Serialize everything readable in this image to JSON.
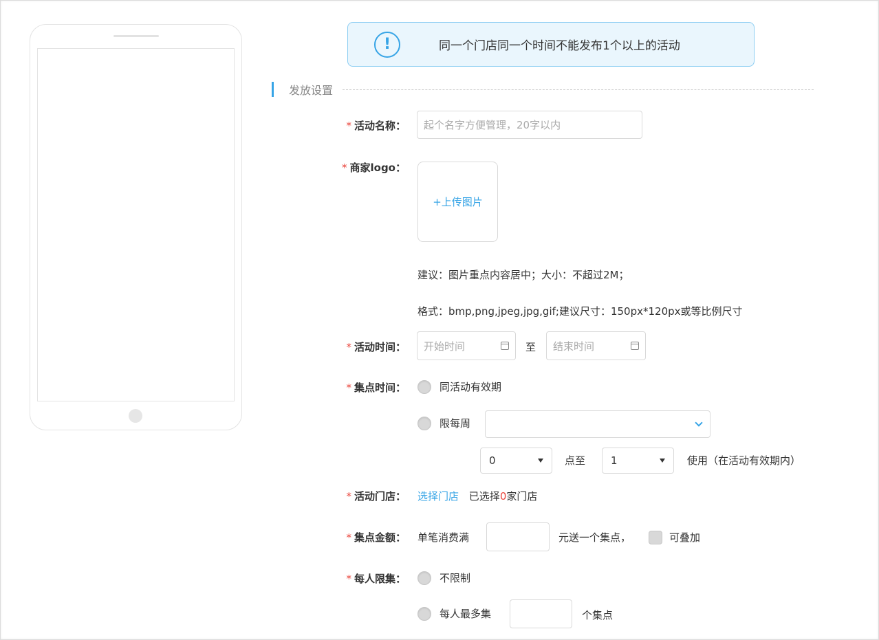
{
  "notice": {
    "icon": "exclamation-circle-icon",
    "text": "同一个门店同一个时间不能发布1个以上的活动"
  },
  "section": {
    "title": "发放设置"
  },
  "fields": {
    "activity_name": {
      "required": "*",
      "label": "活动名称：",
      "placeholder": "起个名字方便管理，20字以内",
      "value": ""
    },
    "merchant_logo": {
      "required": "*",
      "label": "商家logo：",
      "upload_label": "+上传图片",
      "hint1": "建议：图片重点内容居中；大小：不超过2M；",
      "hint2": "格式：bmp,png,jpeg,jpg,gif;建议尺寸：150px*120px或等比例尺寸"
    },
    "activity_time": {
      "required": "*",
      "label": "活动时间：",
      "start_placeholder": "开始时间",
      "separator": "至",
      "end_placeholder": "结束时间"
    },
    "stamp_time": {
      "required": "*",
      "label": "集点时间：",
      "option1": "同活动有效期",
      "option2": "限每周",
      "weekday_value": "",
      "start_hour": "0",
      "hour_sep": "点至",
      "end_hour": "1",
      "suffix": "使用（在活动有效期内）"
    },
    "activity_store": {
      "required": "*",
      "label": "活动门店：",
      "select_link": "选择门店",
      "selected_prefix": "已选择",
      "selected_count": "0",
      "selected_suffix": "家门店"
    },
    "stamp_amount": {
      "required": "*",
      "label": "集点金额：",
      "prefix": "单笔消费满",
      "value": "",
      "suffix": "元送一个集点，",
      "stackable": "可叠加"
    },
    "per_person_limit": {
      "required": "*",
      "label": "每人限集：",
      "option1": "不限制",
      "option2": "每人最多集",
      "value": "",
      "suffix": "个集点"
    }
  },
  "colors": {
    "accent": "#36a4e6",
    "required": "#e9433a",
    "notice_bg": "#eaf6fd"
  }
}
